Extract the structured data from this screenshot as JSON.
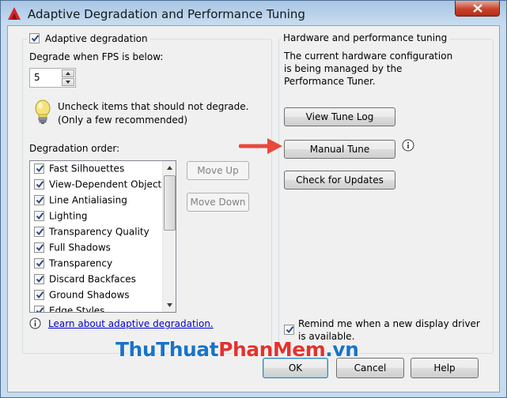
{
  "window": {
    "title": "Adaptive Degradation and Performance Tuning"
  },
  "left": {
    "adaptive_label": "Adaptive degradation",
    "fps_label": "Degrade when FPS is below:",
    "fps_value": "5",
    "hint": [
      "Uncheck items that should not degrade.",
      "(Only a few recommended)"
    ],
    "order_label": "Degradation order:",
    "items": [
      "Fast Silhouettes",
      "View-Dependent Objects",
      "Line Antialiasing",
      "Lighting",
      "Transparency Quality",
      "Full Shadows",
      "Transparency",
      "Discard Backfaces",
      "Ground Shadows",
      "Edge Styles"
    ],
    "move_up": "Move Up",
    "move_down": "Move Down",
    "link": "Learn about adaptive degradation."
  },
  "right": {
    "legend": "Hardware and performance tuning",
    "desc": [
      "The current hardware configuration",
      "is being managed by the",
      "Performance Tuner."
    ],
    "view_log": "View Tune Log",
    "manual_tune": "Manual Tune",
    "check_updates": "Check for Updates",
    "remind": [
      "Remind me when a new display driver",
      "is available."
    ]
  },
  "footer": {
    "ok": "OK",
    "cancel": "Cancel",
    "help": "Help"
  },
  "watermark": {
    "part1": "ThuThuat",
    "part2": "PhanMem",
    "part3": ".vn"
  }
}
